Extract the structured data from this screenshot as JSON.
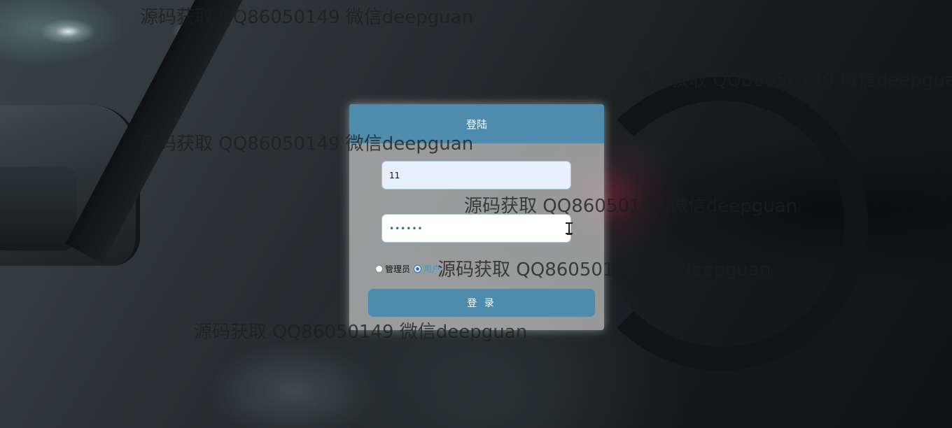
{
  "login": {
    "title": "登陆",
    "username_value": "11",
    "password_value": "••••••",
    "roles": [
      {
        "label": "管理员",
        "checked": false
      },
      {
        "label": "用户",
        "checked": true
      }
    ],
    "submit_label": "登 录"
  },
  "watermark": "源码获取 QQ86050149 微信deepguan",
  "colors": {
    "header": "#4d8cad",
    "button": "#4d8cad",
    "card": "#c8c8c8"
  }
}
